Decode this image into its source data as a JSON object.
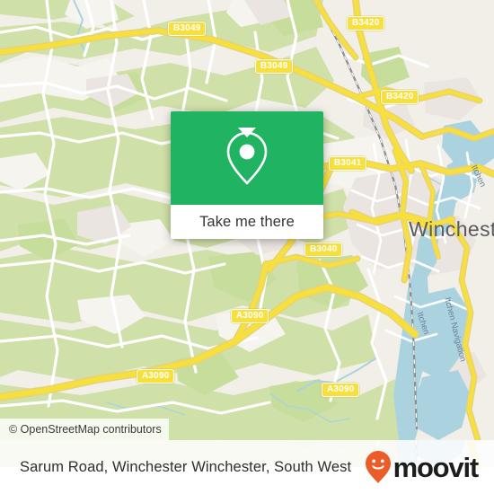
{
  "map": {
    "attribution": "© OpenStreetMap contributors",
    "place_labels": [
      {
        "name": "Winchester",
        "text": "Winchester"
      }
    ],
    "water_labels": [
      {
        "text": "Itchen"
      },
      {
        "text": "Itchen"
      },
      {
        "text": "Itchen Navigation"
      }
    ],
    "road_shields": [
      {
        "text": "B3049"
      },
      {
        "text": "B3420"
      },
      {
        "text": "B3049"
      },
      {
        "text": "B3420"
      },
      {
        "text": "B3041"
      },
      {
        "text": "B3040"
      },
      {
        "text": "A3090"
      },
      {
        "text": "A3090"
      },
      {
        "text": "A3090"
      }
    ],
    "colors": {
      "land": "#f2efe9",
      "green": "#cfe0a8",
      "forest": "#c5dfa0",
      "residential": "#eae5e0",
      "water": "#aad3df",
      "highway_yellow": "#f7e03c",
      "minor_road": "#ffffff",
      "rail": "#777777"
    }
  },
  "popup": {
    "pin_icon": "map-pin-icon",
    "action_label": "Take me there",
    "header_color": "#20b462",
    "body_color": "#ffffff"
  },
  "footer": {
    "title": "Sarum Road, Winchester Winchester, South West",
    "brand_name": "moovit",
    "brand_icon": "moovit-smiley-pin-icon",
    "brand_color": "#ec5c29"
  }
}
